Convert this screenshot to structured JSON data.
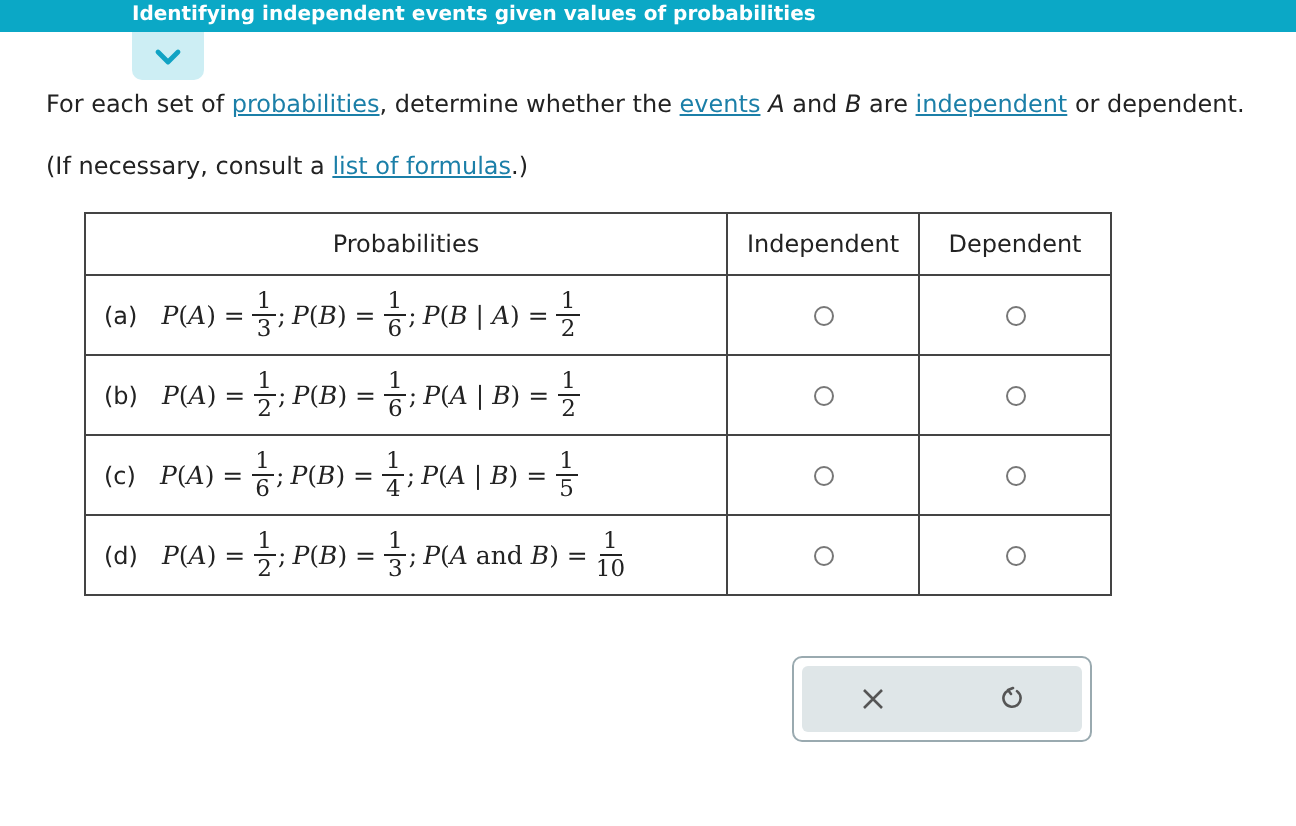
{
  "header": {
    "title": "Identifying independent events given values of probabilities",
    "expanded": false
  },
  "instructions": [
    [
      {
        "kind": "text",
        "text": "For each set of "
      },
      {
        "kind": "link",
        "text": "probabilities"
      },
      {
        "kind": "text",
        "text": ", determine whether the "
      },
      {
        "kind": "link",
        "text": "events"
      },
      {
        "kind": "text",
        "text": " *A* and *B* are "
      },
      {
        "kind": "link",
        "text": "independent"
      },
      {
        "kind": "text",
        "text": " or dependent."
      }
    ],
    [
      {
        "kind": "text",
        "text": "(If necessary, consult a "
      },
      {
        "kind": "link",
        "text": "list of formulas"
      },
      {
        "kind": "text",
        "text": ".)"
      }
    ]
  ],
  "table": {
    "columns": [
      "Probabilities",
      "Independent",
      "Dependent"
    ],
    "rows": [
      {
        "label": "(a)",
        "terms": [
          {
            "lhs": "*P*(*A*) =",
            "num": "1",
            "den": "3",
            "sep": ";"
          },
          {
            "lhs": "*P*(*B*) =",
            "num": "1",
            "den": "6",
            "sep": ";"
          },
          {
            "lhs": "*P*(*B* | *A*) =",
            "num": "1",
            "den": "2"
          }
        ],
        "independent": {
          "selected": false
        },
        "dependent": {
          "selected": false
        }
      },
      {
        "label": "(b)",
        "terms": [
          {
            "lhs": "*P*(*A*) =",
            "num": "1",
            "den": "2",
            "sep": ";"
          },
          {
            "lhs": "*P*(*B*) =",
            "num": "1",
            "den": "6",
            "sep": ";"
          },
          {
            "lhs": "*P*(*A* | *B*) =",
            "num": "1",
            "den": "2"
          }
        ],
        "independent": {
          "selected": false
        },
        "dependent": {
          "selected": false
        }
      },
      {
        "label": "(c)",
        "terms": [
          {
            "lhs": "*P*(*A*) =",
            "num": "1",
            "den": "6",
            "sep": ";"
          },
          {
            "lhs": "*P*(*B*) =",
            "num": "1",
            "den": "4",
            "sep": ";"
          },
          {
            "lhs": "*P*(*A* | *B*) =",
            "num": "1",
            "den": "5"
          }
        ],
        "independent": {
          "selected": false
        },
        "dependent": {
          "selected": false
        }
      },
      {
        "label": "(d)",
        "terms": [
          {
            "lhs": "*P*(*A*) =",
            "num": "1",
            "den": "2",
            "sep": ";"
          },
          {
            "lhs": "*P*(*B*) =",
            "num": "1",
            "den": "3",
            "sep": ";"
          },
          {
            "lhs": "*P*(*A* and *B*) =",
            "num": "1",
            "den": "10"
          }
        ],
        "independent": {
          "selected": false
        },
        "dependent": {
          "selected": false
        }
      }
    ]
  },
  "buttons": [
    {
      "kind": "clear"
    },
    {
      "kind": "reset"
    }
  ]
}
